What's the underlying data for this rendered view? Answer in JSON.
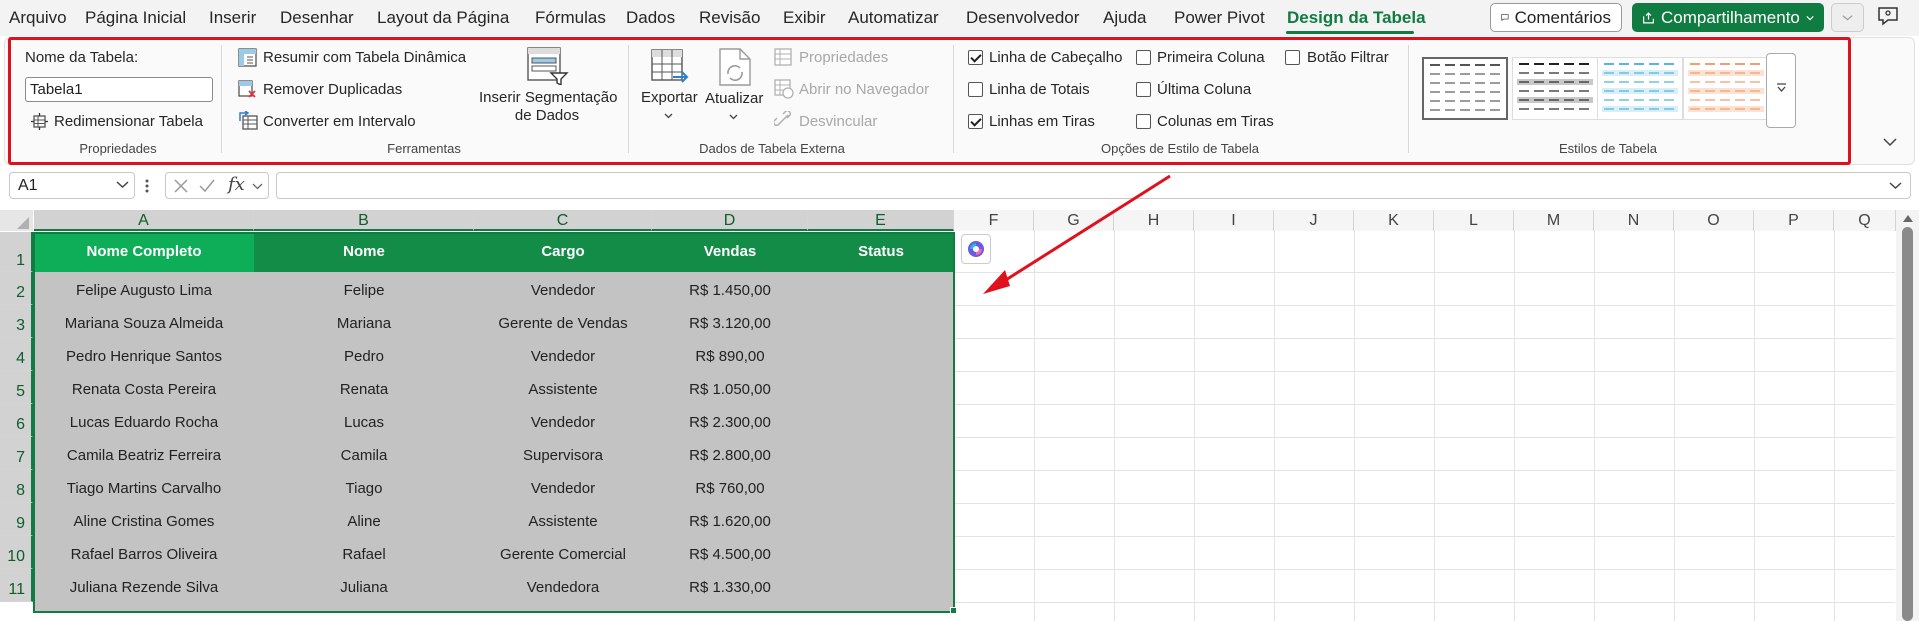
{
  "menu": {
    "tabs": [
      "Arquivo",
      "Página Inicial",
      "Inserir",
      "Desenhar",
      "Layout da Página",
      "Fórmulas",
      "Dados",
      "Revisão",
      "Exibir",
      "Automatizar",
      "Desenvolvedor",
      "Ajuda",
      "Power Pivot",
      "Design da Tabela"
    ],
    "active_tab": "Design da Tabela",
    "comments_label": "Comentários",
    "share_label": "Compartilhamento"
  },
  "ribbon": {
    "properties": {
      "table_name_label": "Nome da Tabela:",
      "table_name_value": "Tabela1",
      "resize_label": "Redimensionar Tabela",
      "group_label": "Propriedades"
    },
    "tools": {
      "pivot_label": "Resumir com Tabela Dinâmica",
      "remove_duplicates_label": "Remover Duplicadas",
      "convert_label": "Converter em Intervalo",
      "slicer_label_line1": "Inserir Segmentação",
      "slicer_label_line2": "de Dados",
      "group_label": "Ferramentas"
    },
    "external": {
      "export_label": "Exportar",
      "refresh_label": "Atualizar",
      "properties_label": "Propriedades",
      "open_browser_label": "Abrir no Navegador",
      "unlink_label": "Desvincular",
      "group_label": "Dados de Tabela Externa"
    },
    "style_options": {
      "header_row": {
        "label": "Linha de Cabeçalho",
        "checked": true
      },
      "total_row": {
        "label": "Linha de Totais",
        "checked": false
      },
      "banded_rows": {
        "label": "Linhas em Tiras",
        "checked": true
      },
      "first_column": {
        "label": "Primeira Coluna",
        "checked": false
      },
      "last_column": {
        "label": "Última Coluna",
        "checked": false
      },
      "banded_columns": {
        "label": "Colunas em Tiras",
        "checked": false
      },
      "filter_button": {
        "label": "Botão Filtrar",
        "checked": false
      },
      "group_label": "Opções de Estilo de Tabela"
    },
    "table_styles": {
      "group_label": "Estilos de Tabela",
      "thumbnails": [
        {
          "name": "none",
          "color": "#555555"
        },
        {
          "name": "dark",
          "color": "#333333"
        },
        {
          "name": "blue",
          "color": "#5ab4e0"
        },
        {
          "name": "orange",
          "color": "#f0a070"
        }
      ]
    }
  },
  "formula_bar": {
    "name_box": "A1",
    "fx": "fx",
    "formula": ""
  },
  "columns": [
    "A",
    "B",
    "C",
    "D",
    "E",
    "F",
    "G",
    "H",
    "I",
    "J",
    "K",
    "L",
    "M",
    "N",
    "O",
    "P",
    "Q"
  ],
  "rows": [
    "1",
    "2",
    "3",
    "4",
    "5",
    "6",
    "7",
    "8",
    "9",
    "10",
    "11"
  ],
  "table": {
    "headers": [
      "Nome Completo",
      "Nome",
      "Cargo",
      "Vendas",
      "Status"
    ],
    "rows": [
      [
        "Felipe Augusto Lima",
        "Felipe",
        "Vendedor",
        "R$ 1.450,00",
        ""
      ],
      [
        "Mariana Souza Almeida",
        "Mariana",
        "Gerente de Vendas",
        "R$ 3.120,00",
        ""
      ],
      [
        "Pedro Henrique Santos",
        "Pedro",
        "Vendedor",
        "R$ 890,00",
        ""
      ],
      [
        "Renata Costa Pereira",
        "Renata",
        "Assistente",
        "R$ 1.050,00",
        ""
      ],
      [
        "Lucas Eduardo Rocha",
        "Lucas",
        "Vendedor",
        "R$ 2.300,00",
        ""
      ],
      [
        "Camila Beatriz Ferreira",
        "Camila",
        "Supervisora",
        "R$ 2.800,00",
        ""
      ],
      [
        "Tiago Martins Carvalho",
        "Tiago",
        "Vendedor",
        "R$ 760,00",
        ""
      ],
      [
        "Aline Cristina Gomes",
        "Aline",
        "Assistente",
        "R$ 1.620,00",
        ""
      ],
      [
        "Rafael Barros Oliveira",
        "Rafael",
        "Gerente Comercial",
        "R$ 4.500,00",
        ""
      ],
      [
        "Juliana Rezende Silva",
        "Juliana",
        "Vendedora",
        "R$ 1.330,00",
        ""
      ]
    ]
  },
  "colors": {
    "accent": "#107c41",
    "annotation": "#e0101d",
    "table_header": "#128c46",
    "table_header_first": "#0eae58",
    "table_body": "#c3c3c3"
  }
}
